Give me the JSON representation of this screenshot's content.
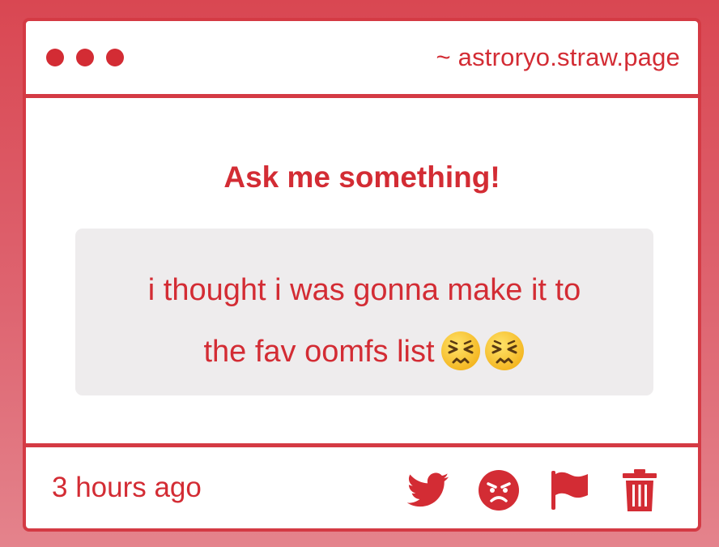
{
  "window": {
    "url": "~ astroryo.straw.page",
    "dot_count": 3
  },
  "prompt": {
    "heading": "Ask me something!"
  },
  "message": {
    "line1": "i thought i was gonna make it to",
    "line2": "the fav oomfs list",
    "emojis": [
      "persevering-face-emoji",
      "persevering-face-emoji"
    ]
  },
  "footer": {
    "timestamp": "3 hours ago",
    "actions": [
      {
        "name": "share-twitter-button",
        "icon": "twitter-bird-icon"
      },
      {
        "name": "block-button",
        "icon": "angry-face-icon"
      },
      {
        "name": "report-button",
        "icon": "flag-icon"
      },
      {
        "name": "delete-button",
        "icon": "trash-icon"
      }
    ]
  },
  "colors": {
    "accent": "#d32c34",
    "border": "#d43a44",
    "message_bg": "#eeeced",
    "page_bg_top": "#d94752",
    "page_bg_bottom": "#e4838c"
  }
}
